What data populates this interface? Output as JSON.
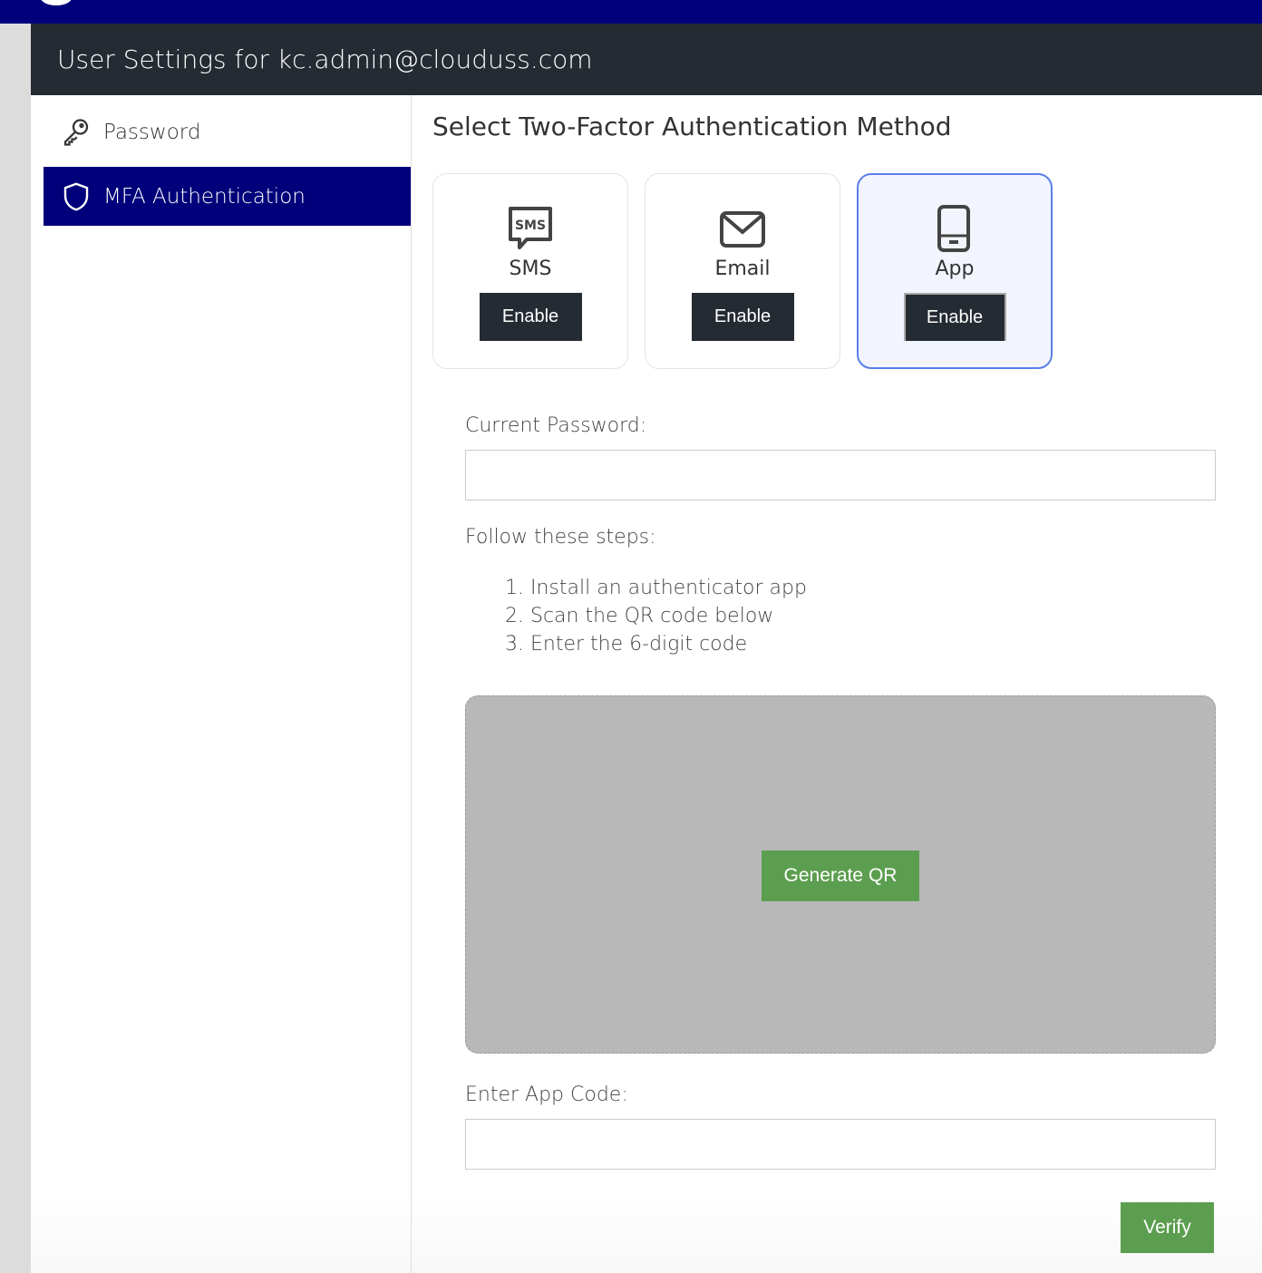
{
  "header": {
    "title": "User Settings for kc.admin@clouduss.com"
  },
  "sidebar": {
    "items": [
      {
        "label": "Password",
        "icon": "key-icon"
      },
      {
        "label": "MFA Authentication",
        "icon": "shield-icon",
        "active": true
      }
    ]
  },
  "main": {
    "title": "Select Two-Factor Authentication Method",
    "methods": [
      {
        "label": "SMS",
        "button": "Enable"
      },
      {
        "label": "Email",
        "button": "Enable"
      },
      {
        "label": "App",
        "button": "Enable",
        "selected": true
      }
    ],
    "current_password_label": "Current Password:",
    "steps_label": "Follow these steps:",
    "steps": [
      "Install an authenticator app",
      "Scan the QR code below",
      "Enter the 6-digit code"
    ],
    "generate_qr": "Generate QR",
    "app_code_label": "Enter App Code:",
    "verify": "Verify"
  },
  "colors": {
    "nav": "#00007a",
    "header": "#252b33",
    "green": "#5c9e4f",
    "selected": "#5a7fe8"
  }
}
